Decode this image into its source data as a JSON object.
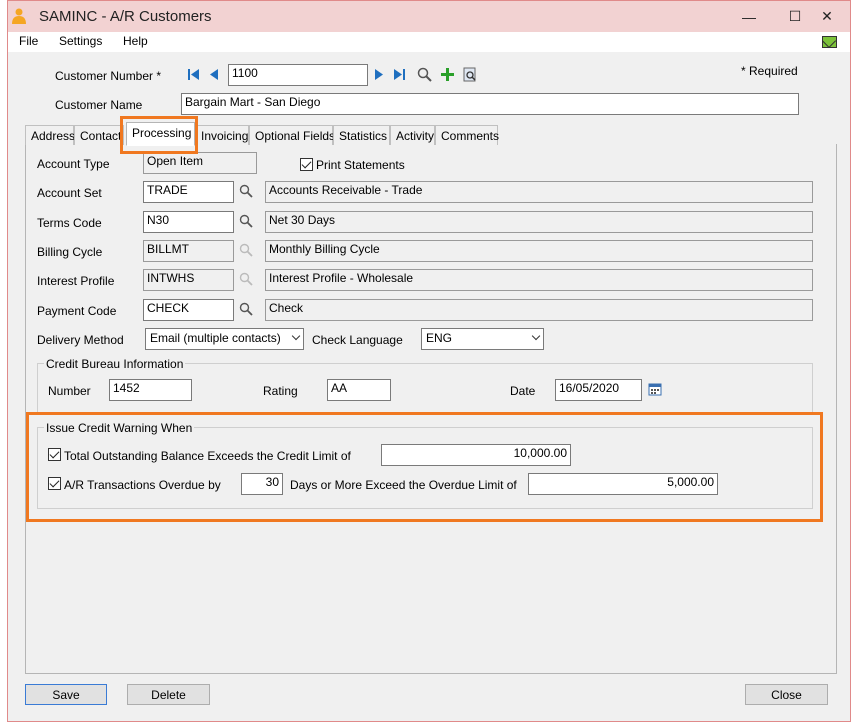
{
  "window": {
    "title": "SAMINC - A/R Customers",
    "minimize_glyph": "—",
    "maximize_glyph": "☐",
    "close_glyph": "✕"
  },
  "menu": [
    "File",
    "Settings",
    "Help"
  ],
  "header": {
    "customer_number_label": "Customer Number *",
    "customer_number": "1100",
    "customer_name_label": "Customer Name",
    "customer_name": "Bargain Mart - San Diego",
    "required_note": "*  Required"
  },
  "tabs": [
    "Address",
    "Contact",
    "Processing",
    "Invoicing",
    "Optional Fields",
    "Statistics",
    "Activity",
    "Comments"
  ],
  "active_tab": "Processing",
  "processing": {
    "account_type_label": "Account Type",
    "account_type": "Open Item",
    "print_statements_label": "Print Statements",
    "print_statements_checked": true,
    "account_set_label": "Account Set",
    "account_set": "TRADE",
    "account_set_desc": "Accounts Receivable - Trade",
    "terms_code_label": "Terms Code",
    "terms_code": "N30",
    "terms_code_desc": "Net 30 Days",
    "billing_cycle_label": "Billing Cycle",
    "billing_cycle": "BILLMT",
    "billing_cycle_desc": "Monthly Billing Cycle",
    "interest_profile_label": "Interest Profile",
    "interest_profile": "INTWHS",
    "interest_profile_desc": "Interest Profile - Wholesale",
    "payment_code_label": "Payment Code",
    "payment_code": "CHECK",
    "payment_code_desc": "Check",
    "delivery_method_label": "Delivery Method",
    "delivery_method": "Email (multiple contacts)",
    "check_language_label": "Check Language",
    "check_language": "ENG"
  },
  "credit_bureau": {
    "title": "Credit Bureau Information",
    "number_label": "Number",
    "number": "1452",
    "rating_label": "Rating",
    "rating": "AA",
    "date_label": "Date",
    "date": "16/05/2020"
  },
  "credit_warning": {
    "title": "Issue Credit Warning When",
    "balance_label": "Total Outstanding Balance Exceeds the Credit Limit of",
    "balance_checked": true,
    "credit_limit": "10,000.00",
    "overdue_label": "A/R Transactions Overdue by",
    "overdue_checked": true,
    "overdue_days": "30",
    "overdue_suffix": "Days or More Exceed the Overdue Limit of",
    "overdue_limit": "5,000.00"
  },
  "buttons": {
    "save": "Save",
    "delete": "Delete",
    "close": "Close"
  },
  "colors": {
    "highlight": "#f07820",
    "titlebar": "#f2d2d2",
    "nav_blue": "#1f6fbf",
    "add_green": "#2aa02a"
  }
}
